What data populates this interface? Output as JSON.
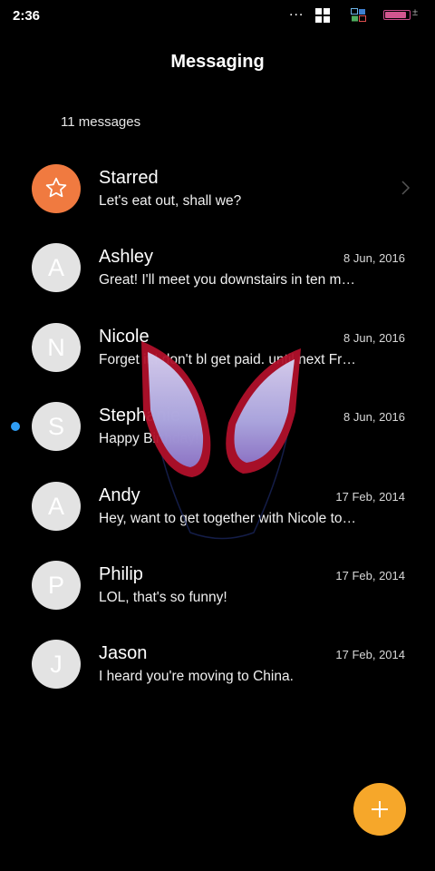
{
  "status_bar": {
    "time": "2:36",
    "dots": "...",
    "battery_level_percent": 90,
    "battery_color": "#d2568f"
  },
  "header": {
    "title": "Messaging"
  },
  "summary": {
    "count_text": "11 messages"
  },
  "conversations": [
    {
      "avatar": "",
      "avatar_icon": "star-icon",
      "avatar_color": "#f07a40",
      "name": "Starred",
      "preview": "Let's eat out, shall we?",
      "date": "",
      "unread": false
    },
    {
      "avatar": "A",
      "name": "Ashley",
      "preview": "Great! I'll meet you downstairs in ten minutes.",
      "date": "8 Jun, 2016",
      "unread": false
    },
    {
      "avatar": "N",
      "name": "Nicole",
      "preview": "Forget it.I don't bl get paid. until next Friday.",
      "date": "8 Jun, 2016",
      "unread": false
    },
    {
      "avatar": "S",
      "name": "Stephanie",
      "preview": "Happy Birthday!",
      "date": "8 Jun, 2016",
      "unread": true
    },
    {
      "avatar": "A",
      "name": "Andy",
      "preview": "Hey, want to get together with Nicole tonight?",
      "date": "17 Feb, 2014",
      "unread": false
    },
    {
      "avatar": "P",
      "name": "Philip",
      "preview": "LOL, that's so funny!",
      "date": "17 Feb, 2014",
      "unread": false
    },
    {
      "avatar": "J",
      "name": "Jason",
      "preview": "I heard you're moving to China.",
      "date": "17 Feb, 2014",
      "unread": false
    }
  ],
  "fab": {
    "icon": "plus-icon",
    "color": "#f6a72a"
  },
  "accent_colors": {
    "unread_dot": "#2f9df4",
    "avatar_gray": "#e3e3e3"
  }
}
